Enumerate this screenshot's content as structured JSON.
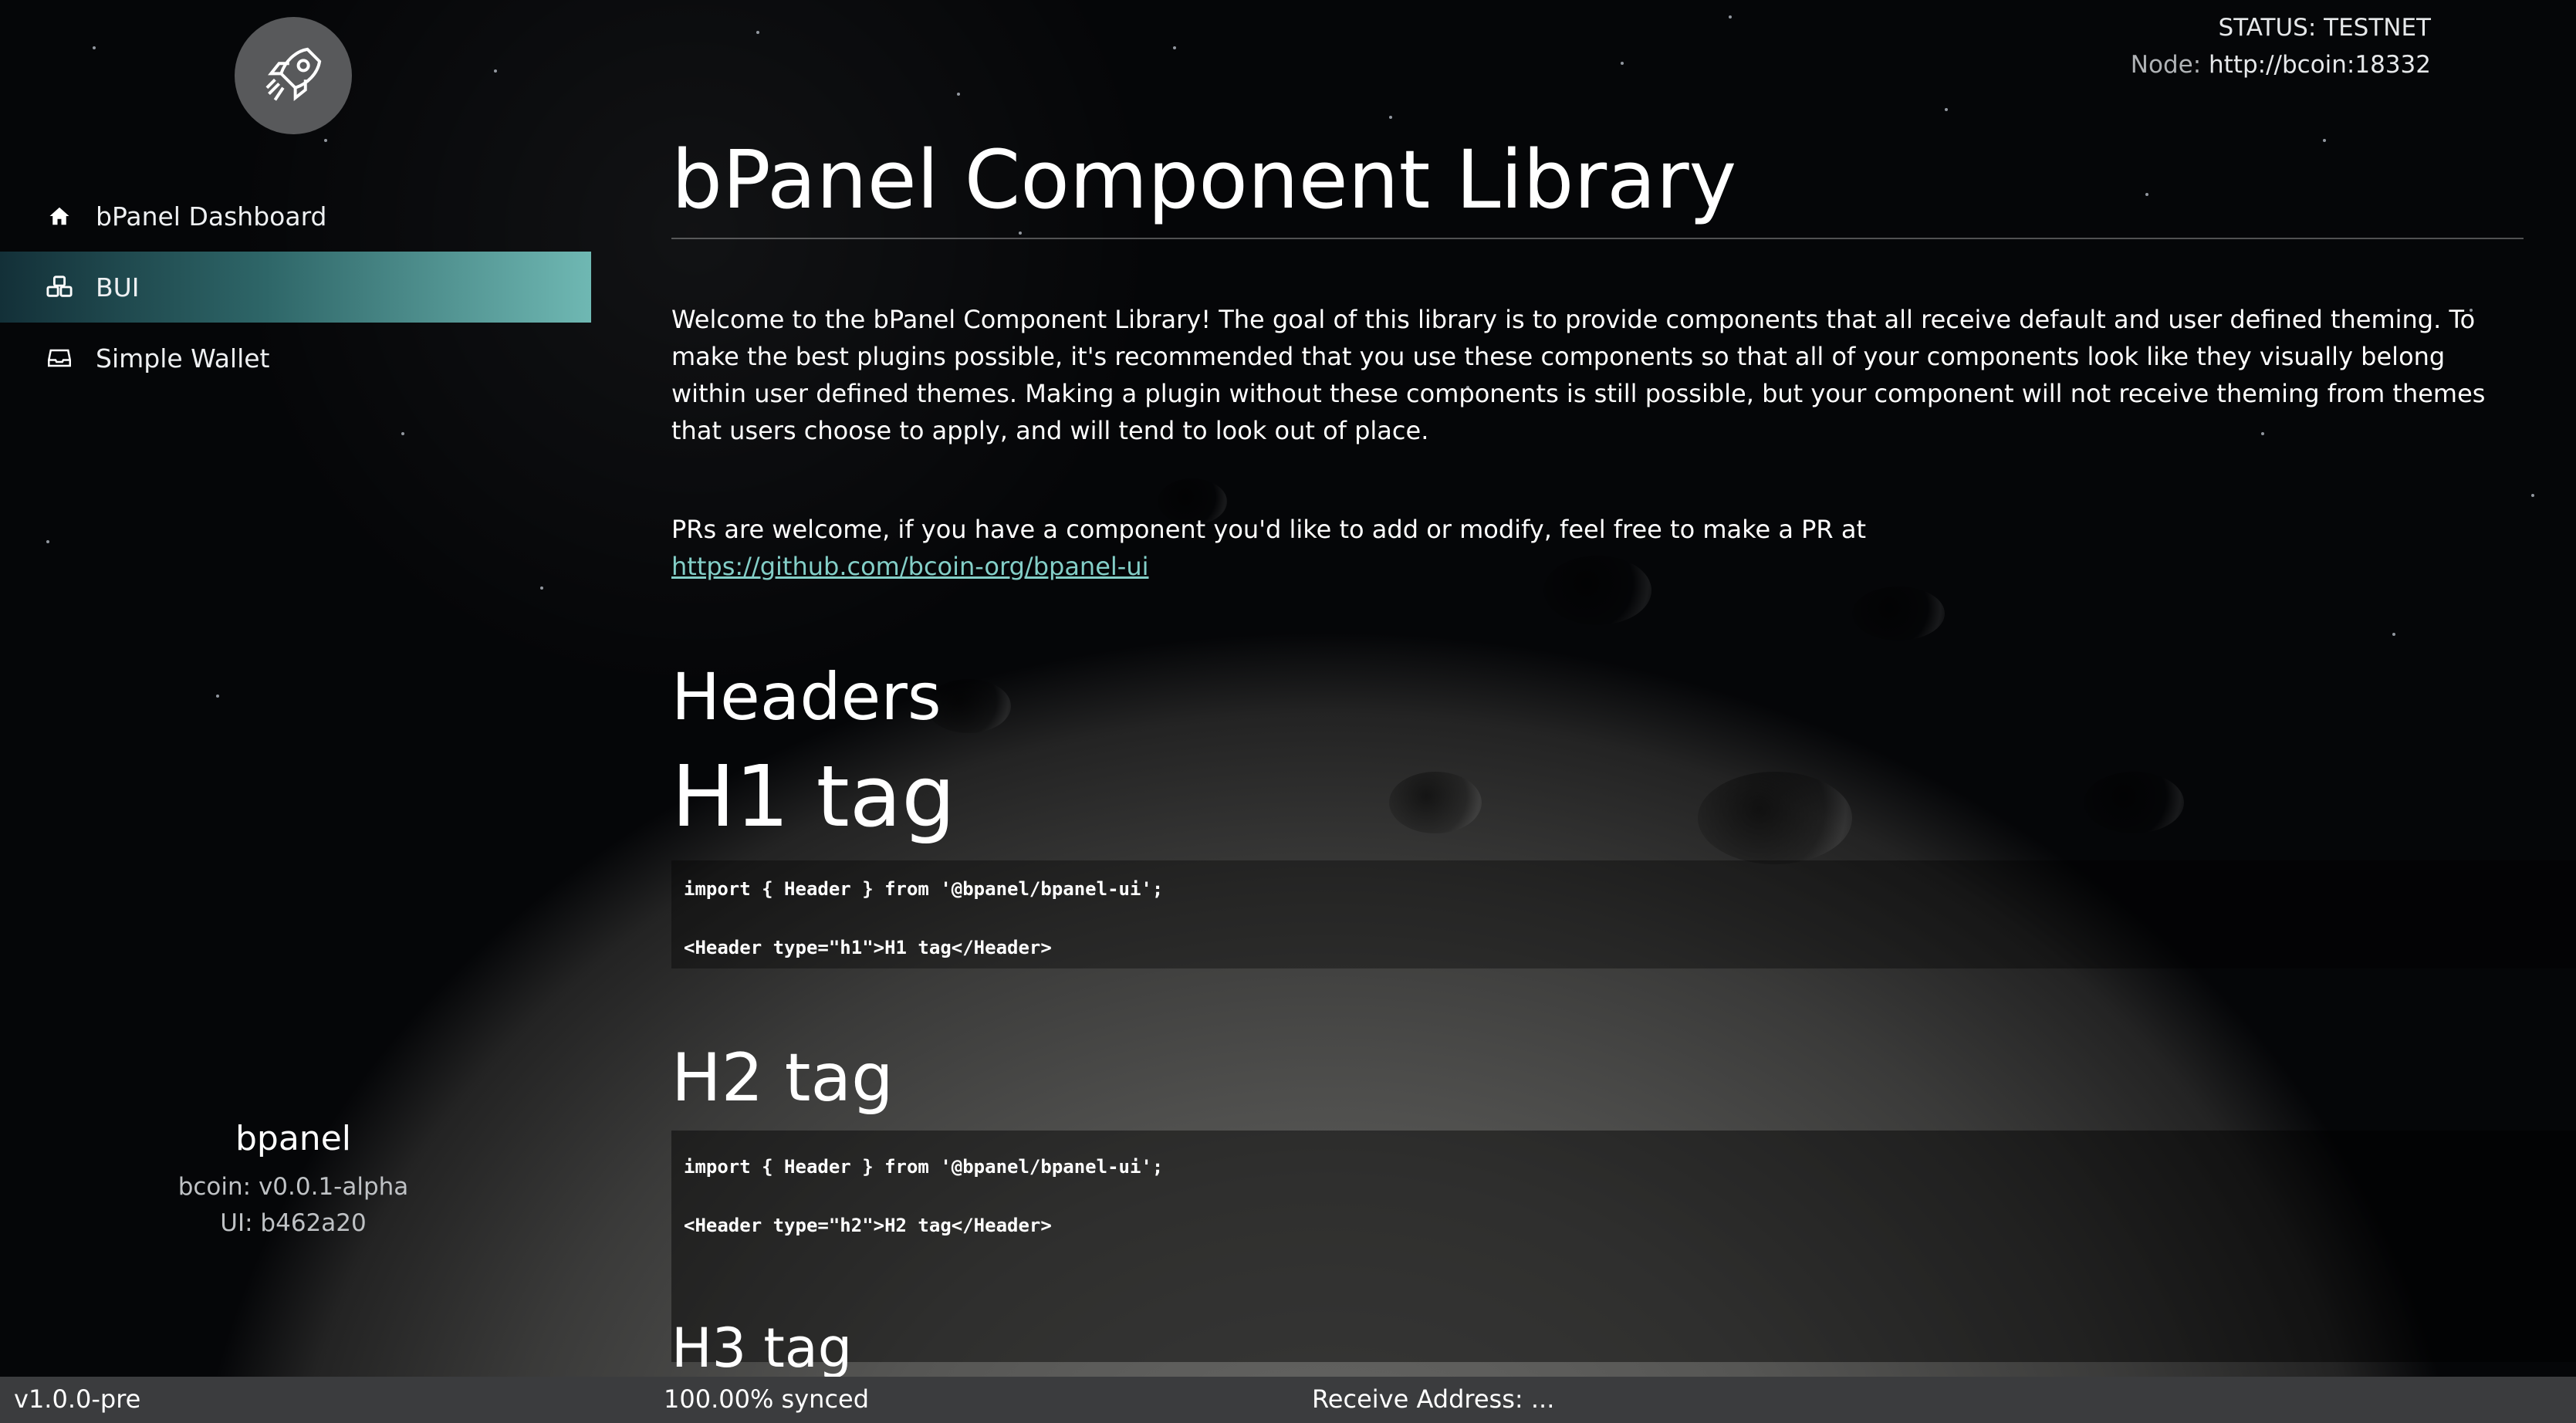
{
  "status": {
    "status_text": "STATUS: TESTNET",
    "node_label": "Node:",
    "node_value": "http://bcoin:18332"
  },
  "sidebar": {
    "logo_icon": "rocket-icon",
    "items": [
      {
        "label": "bPanel Dashboard",
        "icon": "home-icon",
        "active": false
      },
      {
        "label": "BUI",
        "icon": "cubes-icon",
        "active": true
      },
      {
        "label": "Simple Wallet",
        "icon": "inbox-icon",
        "active": false
      }
    ],
    "info": {
      "name": "bpanel",
      "bcoin_version": "bcoin: v0.0.1-alpha",
      "ui_version": "UI: b462a20"
    },
    "accent_color": "#6fb8b3"
  },
  "main": {
    "title": "bPanel Component Library",
    "intro": "Welcome to the bPanel Component Library! The goal of this library is to provide components that all receive default and user defined theming. To make the best plugins possible, it's recommended that you use these components so that all of your components look like they visually belong within user defined themes. Making a plugin without these components is still possible, but your component will not receive theming from themes that users choose to apply, and will tend to look out of place.",
    "pr_text": "PRs are welcome, if you have a component you'd like to add or modify, feel free to make a PR at",
    "pr_link": "https://github.com/bcoin-org/bpanel-ui",
    "link_color": "#84cfc8",
    "section_headers": "Headers",
    "h1_demo": "H1 tag",
    "h1_code_import": "import { Header } from '@bpanel/bpanel-ui';",
    "h1_code_usage": "<Header type=\"h1\">H1 tag</Header>",
    "h2_demo": "H2 tag",
    "h2_code_import": "import { Header } from '@bpanel/bpanel-ui';",
    "h2_code_usage": "<Header type=\"h2\">H2 tag</Header>",
    "h3_demo": "H3 tag"
  },
  "footer": {
    "version": "v1.0.0-pre",
    "sync": "100.00% synced",
    "receive": "Receive Address: ..."
  }
}
